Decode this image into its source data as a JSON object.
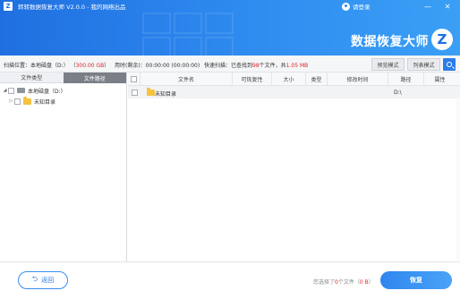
{
  "app": {
    "title": "转转数据恢复大师 V2.0.0 - 我的网络出品",
    "logo_glyph": "Z",
    "login_label": "请登录",
    "brand_text": "数据恢复大师",
    "brand_glyph": "Z",
    "accent_color": "#1f6fe0"
  },
  "window_controls": {
    "minimize": "—",
    "close": "✕"
  },
  "scan_info": {
    "location_label": "扫描位置：本地磁盘（D:）",
    "location_size": "300.00 GB",
    "time_label": "用时(剩余)：00:00:00 (00:00:00)",
    "found_prefix": "快速扫描：已查找到",
    "found_count": "98",
    "found_mid": "个文件，共",
    "found_size": "1.05 MB"
  },
  "view_modes": {
    "preview_label": "预览模式",
    "list_label": "列表模式"
  },
  "left_panel": {
    "tabs": [
      {
        "label": "文件类型",
        "active": false
      },
      {
        "label": "文件路径",
        "active": true
      }
    ],
    "tree": [
      {
        "label": "本地磁盘（D:）",
        "expander": "◢",
        "kind": "drive"
      },
      {
        "label": "未知目录",
        "expander": "▷",
        "kind": "folder"
      }
    ]
  },
  "table": {
    "columns": [
      "文件名",
      "可恢复性",
      "大小",
      "类型",
      "修改时间",
      "路径",
      "属性"
    ],
    "rows": [
      {
        "name": "未知目录",
        "recoverability": "",
        "size": "",
        "type": "",
        "modified": "",
        "path": "D:\\",
        "attr": ""
      }
    ]
  },
  "footer": {
    "back_label": "返回",
    "back_icon": "⮌",
    "selected_prefix": "您选择了",
    "selected_count": "0",
    "selected_mid": "个文件（",
    "selected_size": "0 B",
    "selected_suffix": "）",
    "recover_label": "恢复"
  }
}
